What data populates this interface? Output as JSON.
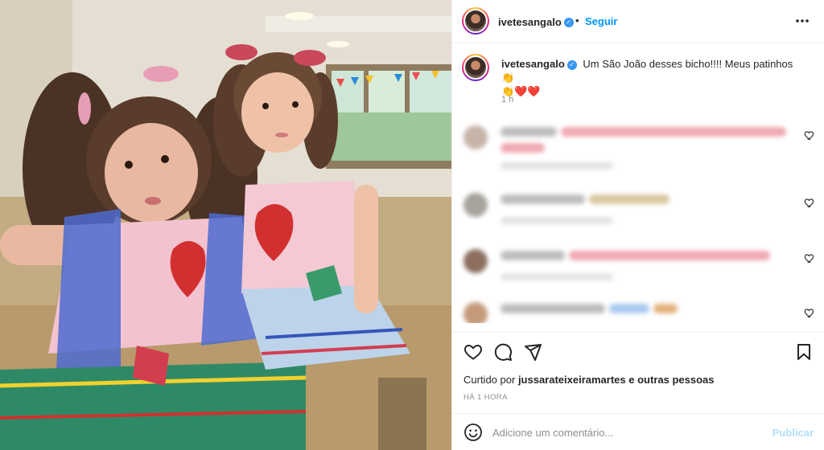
{
  "post": {
    "username": "ivetesangalo",
    "verified_glyph": "✓",
    "separator": "•",
    "follow_label": "Seguir",
    "more_icon": "more-horizontal-icon"
  },
  "caption": {
    "username": "ivetesangalo",
    "text": "Um São João desses bicho!!!! Meus patinhos",
    "emoji_hand": "👏",
    "emoji_hearts": "❤️❤️",
    "time": "1 h"
  },
  "actions": {
    "like_icon": "heart-outline-icon",
    "comment_icon": "comment-bubble-icon",
    "share_icon": "paper-plane-icon",
    "save_icon": "bookmark-icon"
  },
  "likes": {
    "prefix": "Curtido por",
    "user": "jussarateixeiramartes",
    "suffix": "e outras pessoas"
  },
  "timestamp": "HÁ 1 HORA",
  "comment_bar": {
    "placeholder": "Adicione um comentário...",
    "publish_label": "Publicar"
  },
  "colors": {
    "link_blue": "#0095f6",
    "publish_disabled": "#b2dffc",
    "verified_blue": "#3897f0"
  }
}
